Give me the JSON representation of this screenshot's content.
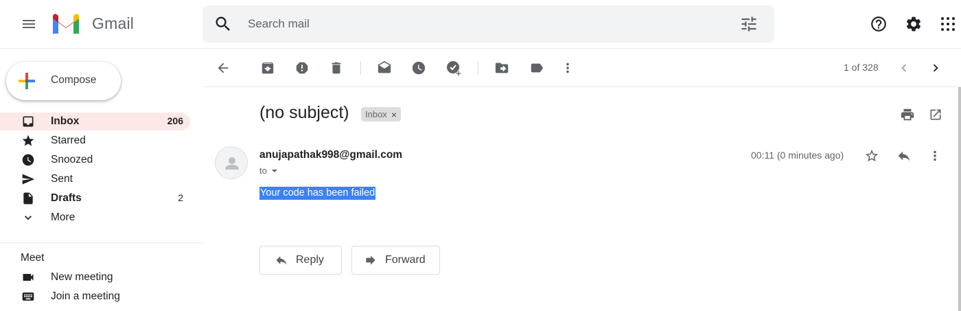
{
  "app": {
    "name": "Gmail"
  },
  "search": {
    "placeholder": "Search mail"
  },
  "compose": {
    "label": "Compose"
  },
  "sidebar": {
    "items": [
      {
        "label": "Inbox",
        "count": "206",
        "icon": "inbox-icon",
        "active": true,
        "bold": true
      },
      {
        "label": "Starred",
        "count": "",
        "icon": "star-icon"
      },
      {
        "label": "Snoozed",
        "count": "",
        "icon": "clock-icon"
      },
      {
        "label": "Sent",
        "count": "",
        "icon": "send-icon"
      },
      {
        "label": "Drafts",
        "count": "2",
        "icon": "draft-icon",
        "bold": true
      },
      {
        "label": "More",
        "count": "",
        "icon": "chevron-down-icon"
      }
    ]
  },
  "meet": {
    "title": "Meet",
    "items": [
      {
        "label": "New meeting",
        "icon": "videocam-icon"
      },
      {
        "label": "Join a meeting",
        "icon": "keyboard-icon"
      }
    ]
  },
  "toolbar": {
    "icons": [
      "back-arrow-icon",
      "archive-icon",
      "report-spam-icon",
      "delete-icon",
      "mark-unread-icon",
      "snooze-icon",
      "add-to-tasks-icon",
      "move-to-icon",
      "label-icon",
      "more-vert-icon"
    ],
    "pager": "1 of 328"
  },
  "message": {
    "subject": "(no subject)",
    "label": "Inbox",
    "label_remove": "×",
    "sender": "anujapathak998@gmail.com",
    "to": "to",
    "time": "00:11 (0 minutes ago)",
    "body": "Your code has been failed"
  },
  "actions": {
    "reply": "Reply",
    "forward": "Forward"
  },
  "colors": {
    "active_bg": "#fce8e6",
    "selection": "#3b82f6",
    "icon": "#5f6368"
  }
}
